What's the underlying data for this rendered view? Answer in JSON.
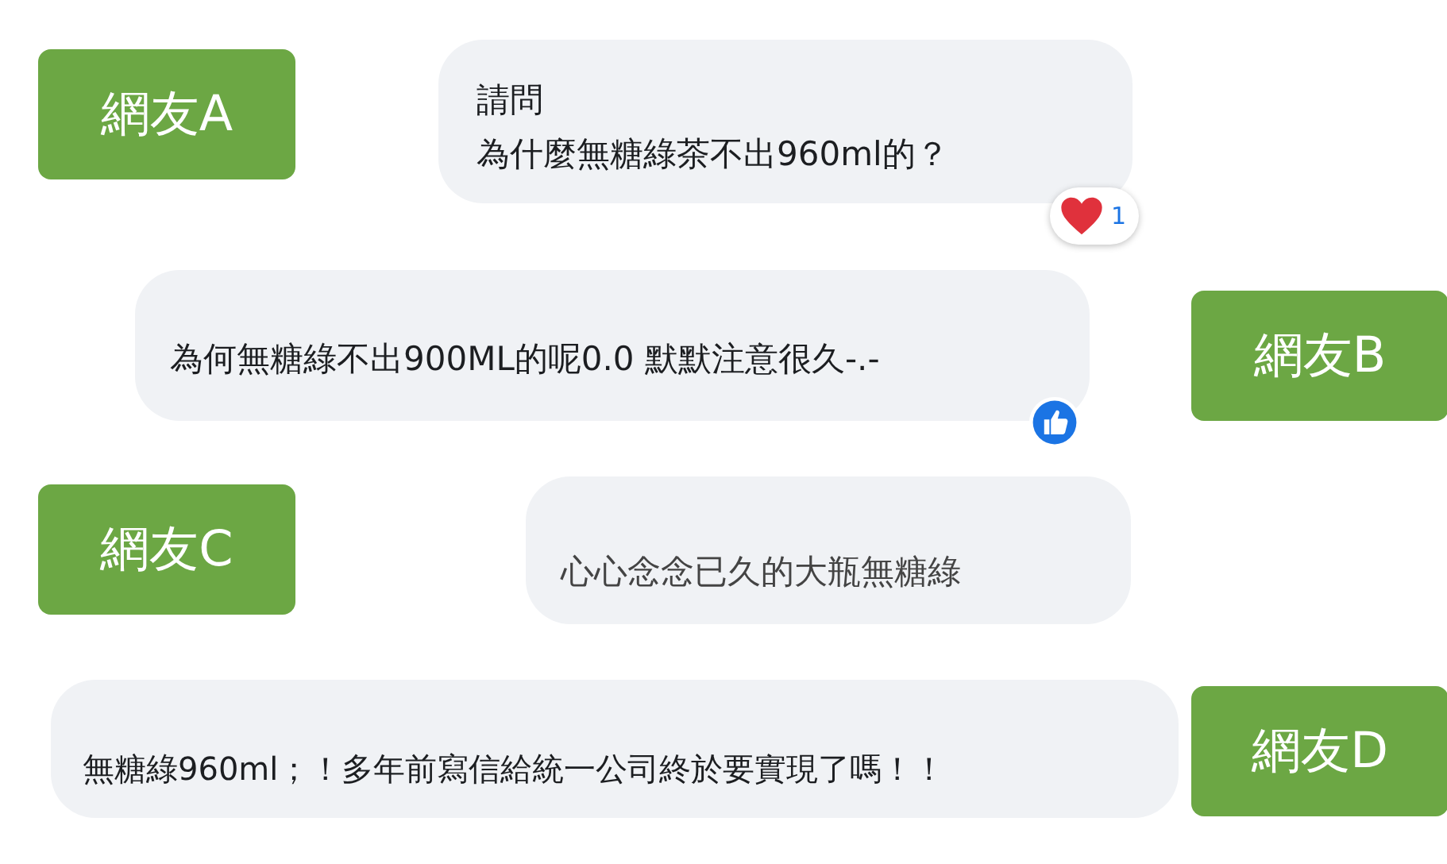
{
  "comments": [
    {
      "user": "網友A",
      "name_on_right": false,
      "lines": [
        "請問",
        "為什麼無糖綠茶不出960ml的？"
      ],
      "reaction": {
        "kind": "heart",
        "count": "1"
      }
    },
    {
      "user": "網友B",
      "name_on_right": true,
      "lines": [
        "為何無糖綠不出900ML的呢0.0 默默注意很久-.-"
      ],
      "reaction": {
        "kind": "like"
      }
    },
    {
      "user": "網友C",
      "name_on_right": false,
      "lines": [
        "心心念念已久的大瓶無糖綠"
      ]
    },
    {
      "user": "網友D",
      "name_on_right": true,
      "lines": [
        "無糖綠960ml；！多年前寫信給統一公司終於要實現了嗎！！"
      ]
    }
  ]
}
